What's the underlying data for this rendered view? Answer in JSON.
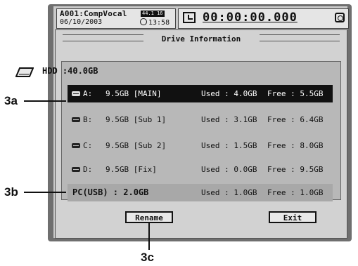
{
  "header": {
    "project_name": "A001:CompVocal",
    "project_badge": "44.1 16",
    "date": "06/10/2003",
    "time": "13:58",
    "counter": "00:00:00.000"
  },
  "dialog": {
    "title": "Drive Information",
    "hdd_label": "HDD :40.0GB",
    "drives": [
      {
        "letter": "A:",
        "size": "9.5GB [MAIN]",
        "used": "Used : 4.0GB",
        "free": "Free : 5.5GB"
      },
      {
        "letter": "B:",
        "size": "9.5GB [Sub 1]",
        "used": "Used : 3.1GB",
        "free": "Free : 6.4GB"
      },
      {
        "letter": "C:",
        "size": "9.5GB [Sub 2]",
        "used": "Used : 1.5GB",
        "free": "Free : 8.0GB"
      },
      {
        "letter": "D:",
        "size": "9.5GB [Fix]",
        "used": "Used : 0.0GB",
        "free": "Free : 9.5GB"
      }
    ],
    "pc": {
      "name": "PC(USB) : 2.0GB",
      "used": "Used : 1.0GB",
      "free": "Free : 1.0GB"
    },
    "rename_label": "Rename",
    "exit_label": "Exit"
  },
  "callouts": {
    "a": "3a",
    "b": "3b",
    "c": "3c"
  },
  "icons": [
    "clock-icon",
    "alarm-icon",
    "hdd-icon",
    "disk-icon"
  ]
}
